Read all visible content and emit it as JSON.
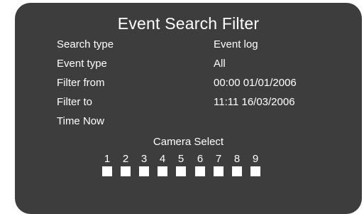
{
  "title": "Event Search Filter",
  "fields": [
    {
      "label": "Search type",
      "value": "Event log"
    },
    {
      "label": "Event type",
      "value": "All"
    },
    {
      "label": "Filter from",
      "value": "00:00 01/01/2006"
    },
    {
      "label": "Filter to",
      "value": "11:11 16/03/2006"
    },
    {
      "label": "Time Now",
      "value": ""
    }
  ],
  "camera_select": {
    "label": "Camera Select",
    "cameras": [
      "1",
      "2",
      "3",
      "4",
      "5",
      "6",
      "7",
      "8",
      "9"
    ]
  },
  "colors": {
    "panel_bg": "#3d3d3d",
    "text": "#ffffff",
    "checkbox": "#ffffff"
  }
}
